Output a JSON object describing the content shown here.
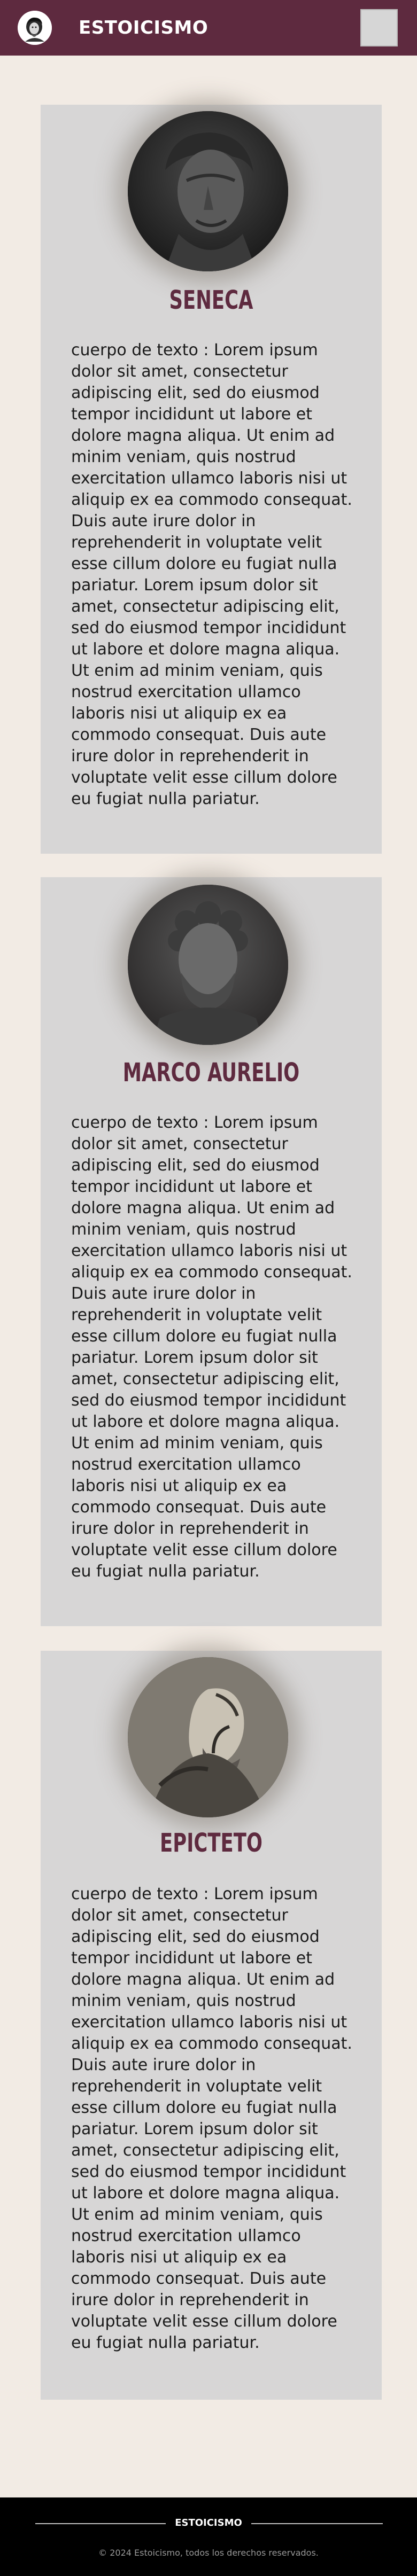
{
  "header": {
    "brand": "ESTOICISMO",
    "logo_icon": "philosopher-bust-icon",
    "menu_icon": "menu-icon",
    "background": "#5e2a3f"
  },
  "philosophers": [
    {
      "name": "SENECA",
      "portrait_icon": "seneca-bust-portrait",
      "body": "cuerpo de texto : Lorem ipsum dolor sit amet, consectetur adipiscing elit, sed do eiusmod tempor incididunt ut labore et dolore magna aliqua. Ut enim ad minim veniam, quis nostrud exercitation ullamco laboris nisi ut aliquip ex ea commodo consequat. Duis aute irure dolor in reprehenderit in voluptate velit esse cillum dolore eu fugiat nulla pariatur. Lorem ipsum dolor sit amet, consectetur adipiscing elit, sed do eiusmod tempor incididunt ut labore et dolore magna aliqua. Ut enim ad minim veniam, quis nostrud exercitation ullamco laboris nisi ut aliquip ex ea commodo consequat. Duis aute irure dolor in reprehenderit in voluptate velit esse cillum dolore eu fugiat nulla pariatur."
    },
    {
      "name": "MARCO AURELIO",
      "portrait_icon": "marco-aurelio-bust-portrait",
      "body": "cuerpo de texto : Lorem ipsum dolor sit amet, consectetur adipiscing elit, sed do eiusmod tempor incididunt ut labore et dolore magna aliqua. Ut enim ad minim veniam, quis nostrud exercitation ullamco laboris nisi ut aliquip ex ea commodo consequat. Duis aute irure dolor in reprehenderit in voluptate velit esse cillum dolore eu fugiat nulla pariatur. Lorem ipsum dolor sit amet, consectetur adipiscing elit, sed do eiusmod tempor incididunt ut labore et dolore magna aliqua. Ut enim ad minim veniam, quis nostrud exercitation ullamco laboris nisi ut aliquip ex ea commodo consequat. Duis aute irure dolor in reprehenderit in voluptate velit esse cillum dolore eu fugiat nulla pariatur."
    },
    {
      "name": "EPICTETO",
      "portrait_icon": "epicteto-engraving-portrait",
      "body": "cuerpo de texto : Lorem ipsum dolor sit amet, consectetur adipiscing elit, sed do eiusmod tempor incididunt ut labore et dolore magna aliqua. Ut enim ad minim veniam, quis nostrud exercitation ullamco laboris nisi ut aliquip ex ea commodo consequat. Duis aute irure dolor in reprehenderit in voluptate velit esse cillum dolore eu fugiat nulla pariatur. Lorem ipsum dolor sit amet, consectetur adipiscing elit, sed do eiusmod tempor incididunt ut labore et dolore magna aliqua. Ut enim ad minim veniam, quis nostrud exercitation ullamco laboris nisi ut aliquip ex ea commodo consequat. Duis aute irure dolor in reprehenderit in voluptate velit esse cillum dolore eu fugiat nulla pariatur."
    }
  ],
  "footer": {
    "brand": "ESTOICISMO",
    "copyright": "© 2024 Estoicismo, todos los derechos reservados."
  },
  "colors": {
    "accent": "#5e2a3f",
    "page_background": "#f2ebe4",
    "card_background": "#d7d6d6",
    "footer_background": "#000000"
  }
}
